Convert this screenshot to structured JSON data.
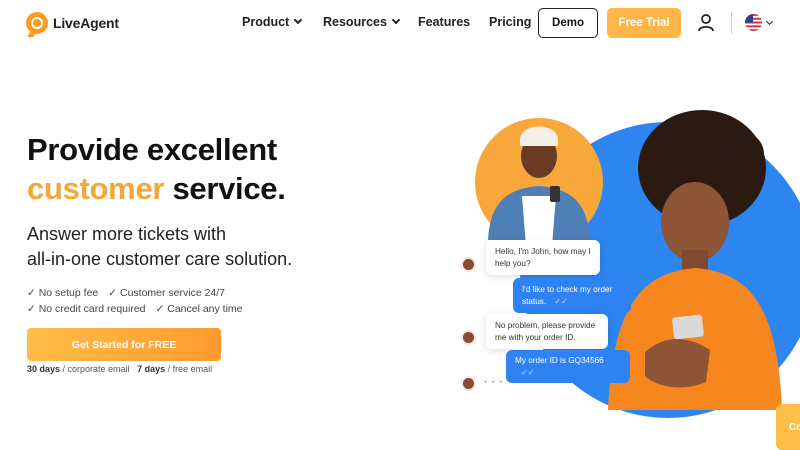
{
  "nav": {
    "logo_text": "LiveAgent",
    "items": [
      {
        "label": "Product",
        "dropdown": true
      },
      {
        "label": "Resources",
        "dropdown": true
      },
      {
        "label": "Features",
        "dropdown": false
      },
      {
        "label": "Pricing",
        "dropdown": false
      }
    ],
    "demo_label": "Demo",
    "trial_label": "Free Trial",
    "icons": [
      "user-icon",
      "us-flag-icon",
      "chevron-down-icon"
    ]
  },
  "hero": {
    "title_line1": "Provide excellent",
    "title_accent": "customer",
    "title_rest": " service.",
    "subtitle_line1": "Answer more tickets with",
    "subtitle_line2": "all-in-one customer care solution.",
    "checks": [
      "✓ No setup fee",
      "✓ Customer service 24/7",
      "✓ No credit card required",
      "✓ Cancel any time"
    ],
    "cta_label": "Get Started for FREE",
    "trial_days_1": "30 days",
    "trial_text_1": " / corporate email",
    "trial_days_2": "7 days",
    "trial_text_2": " / free email"
  },
  "chat": {
    "messages": [
      {
        "from": "agent",
        "text": "Hello, I'm John, how may I help you?"
      },
      {
        "from": "customer",
        "text": "I'd like to check my order status."
      },
      {
        "from": "agent",
        "text": "No problem, please provide me with your order ID."
      },
      {
        "from": "customer",
        "text": "My order ID is GQ34566"
      }
    ],
    "typing": "• • •",
    "read_ticks": "✓✓"
  },
  "side_tab": "Co",
  "colors": {
    "accent": "#f4a637",
    "cta": "#ff9a2e",
    "chat_blue": "#2f82f2",
    "circle_blue": "#2d85f0"
  }
}
